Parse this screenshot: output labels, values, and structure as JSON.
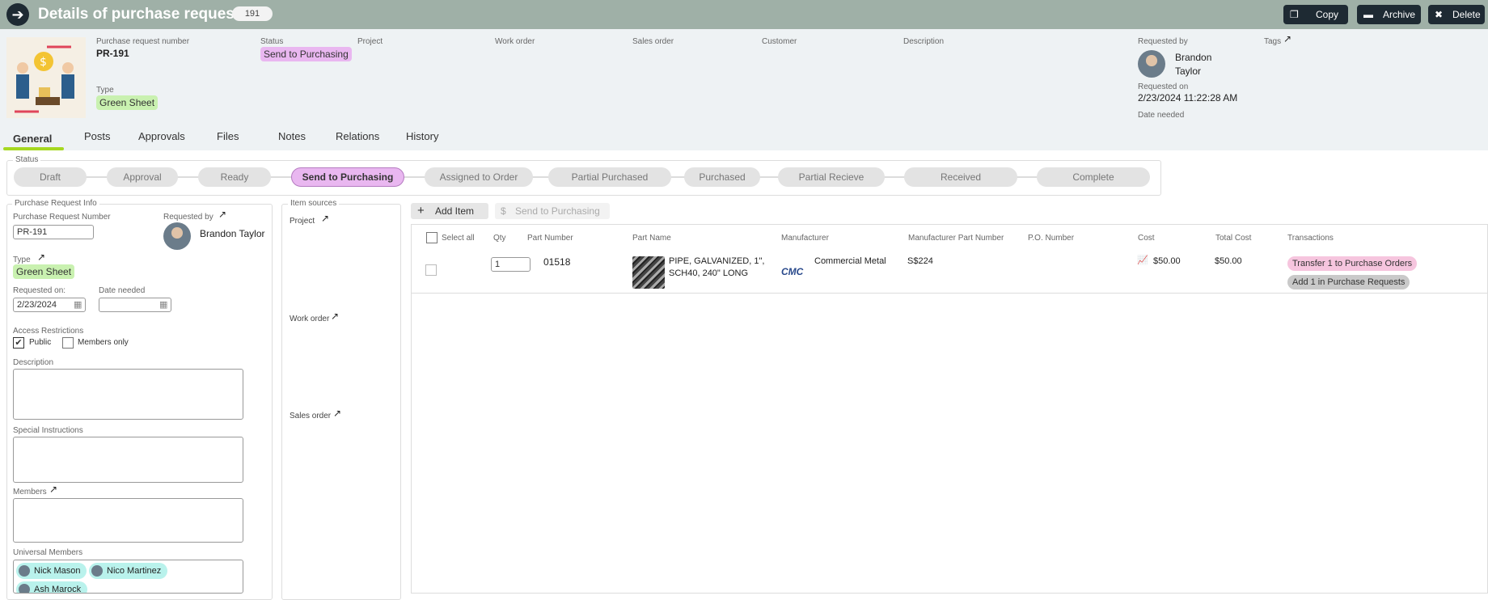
{
  "header": {
    "title": "Details of purchase request",
    "id_badge": "191",
    "buttons": {
      "copy": "Copy",
      "archive": "Archive",
      "delete": "Delete"
    }
  },
  "info": {
    "pr_number_label": "Purchase request number",
    "pr_number": "PR-191",
    "status_label": "Status",
    "status": "Send to Purchasing",
    "project_label": "Project",
    "work_order_label": "Work order",
    "sales_order_label": "Sales order",
    "customer_label": "Customer",
    "description_label": "Description",
    "type_label": "Type",
    "type": "Green Sheet",
    "requested_by_label": "Requested by",
    "requested_by_first": "Brandon",
    "requested_by_last": "Taylor",
    "tags_label": "Tags",
    "requested_on_label": "Requested on",
    "requested_on": "2/23/2024 11:22:28 AM",
    "date_needed_label": "Date needed"
  },
  "tabs": [
    "General",
    "Posts",
    "Approvals",
    "Files",
    "Notes",
    "Relations",
    "History"
  ],
  "status_section": {
    "legend": "Status",
    "steps": [
      "Draft",
      "Approval",
      "Ready",
      "Send to Purchasing",
      "Assigned to Order",
      "Partial Purchased",
      "Purchased",
      "Partial Recieve",
      "Received",
      "Complete"
    ],
    "active": "Send to Purchasing"
  },
  "pr_info": {
    "legend": "Purchase Request Info",
    "number_label": "Purchase Request Number",
    "number": "PR-191",
    "requested_by_label": "Requested by",
    "requested_by": "Brandon Taylor",
    "type_label": "Type",
    "type": "Green Sheet",
    "requested_on_label": "Requested on:",
    "requested_on": "2/23/2024",
    "date_needed_label": "Date needed",
    "date_needed": "",
    "access_label": "Access Restrictions",
    "public_label": "Public",
    "members_only_label": "Members only",
    "description_label": "Description",
    "special_instructions_label": "Special Instructions",
    "members_label": "Members",
    "universal_members_label": "Universal Members",
    "universal_members": [
      "Nick Mason",
      "Nico Martinez",
      "Ash Marock"
    ]
  },
  "item_sources": {
    "legend": "Item sources",
    "project_label": "Project",
    "work_order_label": "Work order",
    "sales_order_label": "Sales order"
  },
  "items": {
    "add_item": "Add Item",
    "send_to_purchasing": "Send to Purchasing",
    "select_all": "Select all",
    "columns": [
      "Qty",
      "Part Number",
      "Part Name",
      "Manufacturer",
      "Manufacturer Part Number",
      "P.O. Number",
      "Cost",
      "Total Cost",
      "Transactions"
    ],
    "rows": [
      {
        "qty": "1",
        "part_number": "01518",
        "part_name_line1": "PIPE, GALVANIZED, 1\",",
        "part_name_line2": "SCH40, 240\" LONG",
        "manufacturer_logo": "CMC",
        "manufacturer": "Commercial Metal",
        "manufacturer_part_number": "S$224",
        "po_number": "",
        "cost": "$50.00",
        "total_cost": "$50.00",
        "transaction_1": "Transfer 1 to Purchase Orders",
        "transaction_2": "Add 1 in Purchase Requests"
      }
    ]
  }
}
